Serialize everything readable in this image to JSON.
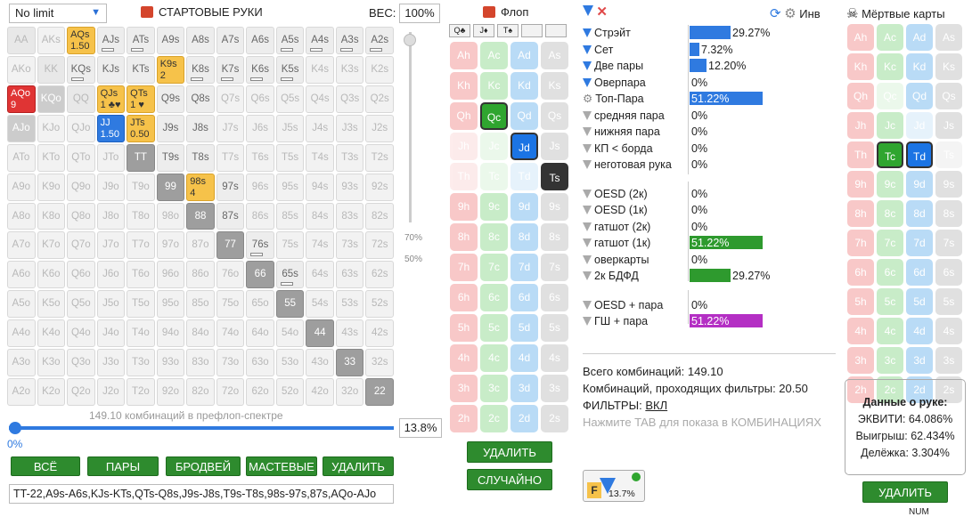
{
  "topbar": {
    "limit": "No limit",
    "title": "СТАРТОВЫЕ РУКИ",
    "weight_label": "ВЕС:",
    "weight_value": "100%"
  },
  "grid": [
    [
      {
        "t": "AA",
        "c": "pair"
      },
      {
        "t": "AKs"
      },
      {
        "t": "AQs",
        "c": "yel",
        "s": "1.50"
      },
      {
        "t": "AJs",
        "c": "dk",
        "bar": 1
      },
      {
        "t": "ATs",
        "c": "dk",
        "bar": 1
      },
      {
        "t": "A9s",
        "c": "dk"
      },
      {
        "t": "A8s",
        "c": "dk"
      },
      {
        "t": "A7s",
        "c": "dk"
      },
      {
        "t": "A6s",
        "c": "dk"
      },
      {
        "t": "A5s",
        "c": "dk",
        "bar": 1
      },
      {
        "t": "A4s",
        "c": "dk",
        "bar": 1
      },
      {
        "t": "A3s",
        "c": "dk",
        "bar": 1
      },
      {
        "t": "A2s",
        "c": "dk",
        "bar": 1
      }
    ],
    [
      {
        "t": "AKo"
      },
      {
        "t": "KK",
        "c": "pair"
      },
      {
        "t": "KQs",
        "c": "dk",
        "bar": 1
      },
      {
        "t": "KJs",
        "c": "dk"
      },
      {
        "t": "KTs",
        "c": "dk"
      },
      {
        "t": "K9s",
        "c": "yel",
        "s": "2"
      },
      {
        "t": "K8s",
        "c": "dk",
        "bar": 1
      },
      {
        "t": "K7s",
        "c": "dk",
        "bar": 1
      },
      {
        "t": "K6s",
        "c": "dk",
        "bar": 1
      },
      {
        "t": "K5s",
        "c": "dk",
        "bar": 1
      },
      {
        "t": "K4s"
      },
      {
        "t": "K3s"
      },
      {
        "t": "K2s"
      }
    ],
    [
      {
        "t": "AQo",
        "c": "red",
        "s": "9"
      },
      {
        "t": "KQo",
        "c": "mixed"
      },
      {
        "t": "QQ",
        "c": "pair"
      },
      {
        "t": "QJs",
        "c": "yel",
        "s": "1 ♣♥"
      },
      {
        "t": "QTs",
        "c": "yel",
        "s": "1 ♥"
      },
      {
        "t": "Q9s",
        "c": "dk"
      },
      {
        "t": "Q8s",
        "c": "dk"
      },
      {
        "t": "Q7s"
      },
      {
        "t": "Q6s"
      },
      {
        "t": "Q5s"
      },
      {
        "t": "Q4s"
      },
      {
        "t": "Q3s"
      },
      {
        "t": "Q2s"
      }
    ],
    [
      {
        "t": "AJo",
        "c": "mixed"
      },
      {
        "t": "KJo"
      },
      {
        "t": "QJo"
      },
      {
        "t": "JJ",
        "c": "blue",
        "s": "1.50"
      },
      {
        "t": "JTs",
        "c": "yel",
        "s": "0.50"
      },
      {
        "t": "J9s",
        "c": "dk"
      },
      {
        "t": "J8s",
        "c": "dk"
      },
      {
        "t": "J7s"
      },
      {
        "t": "J6s"
      },
      {
        "t": "J5s"
      },
      {
        "t": "J4s"
      },
      {
        "t": "J3s"
      },
      {
        "t": "J2s"
      }
    ],
    [
      {
        "t": "ATo"
      },
      {
        "t": "KTo"
      },
      {
        "t": "QTo"
      },
      {
        "t": "JTo"
      },
      {
        "t": "TT",
        "c": "gray"
      },
      {
        "t": "T9s",
        "c": "dk"
      },
      {
        "t": "T8s",
        "c": "dk"
      },
      {
        "t": "T7s"
      },
      {
        "t": "T6s"
      },
      {
        "t": "T5s"
      },
      {
        "t": "T4s"
      },
      {
        "t": "T3s"
      },
      {
        "t": "T2s"
      }
    ],
    [
      {
        "t": "A9o"
      },
      {
        "t": "K9o"
      },
      {
        "t": "Q9o"
      },
      {
        "t": "J9o"
      },
      {
        "t": "T9o"
      },
      {
        "t": "99",
        "c": "gray"
      },
      {
        "t": "98s",
        "c": "yel",
        "s": "4"
      },
      {
        "t": "97s",
        "c": "dk"
      },
      {
        "t": "96s"
      },
      {
        "t": "95s"
      },
      {
        "t": "94s"
      },
      {
        "t": "93s"
      },
      {
        "t": "92s"
      }
    ],
    [
      {
        "t": "A8o"
      },
      {
        "t": "K8o"
      },
      {
        "t": "Q8o"
      },
      {
        "t": "J8o"
      },
      {
        "t": "T8o"
      },
      {
        "t": "98o"
      },
      {
        "t": "88",
        "c": "gray"
      },
      {
        "t": "87s",
        "c": "dk"
      },
      {
        "t": "86s"
      },
      {
        "t": "85s"
      },
      {
        "t": "84s"
      },
      {
        "t": "83s"
      },
      {
        "t": "82s"
      }
    ],
    [
      {
        "t": "A7o"
      },
      {
        "t": "K7o"
      },
      {
        "t": "Q7o"
      },
      {
        "t": "J7o"
      },
      {
        "t": "T7o"
      },
      {
        "t": "97o"
      },
      {
        "t": "87o"
      },
      {
        "t": "77",
        "c": "gray"
      },
      {
        "t": "76s",
        "c": "dk",
        "bar": 1
      },
      {
        "t": "75s"
      },
      {
        "t": "74s"
      },
      {
        "t": "73s"
      },
      {
        "t": "72s"
      }
    ],
    [
      {
        "t": "A6o"
      },
      {
        "t": "K6o"
      },
      {
        "t": "Q6o"
      },
      {
        "t": "J6o"
      },
      {
        "t": "T6o"
      },
      {
        "t": "96o"
      },
      {
        "t": "86o"
      },
      {
        "t": "76o"
      },
      {
        "t": "66",
        "c": "gray"
      },
      {
        "t": "65s",
        "c": "dk",
        "bar": 1
      },
      {
        "t": "64s"
      },
      {
        "t": "63s"
      },
      {
        "t": "62s"
      }
    ],
    [
      {
        "t": "A5o"
      },
      {
        "t": "K5o"
      },
      {
        "t": "Q5o"
      },
      {
        "t": "J5o"
      },
      {
        "t": "T5o"
      },
      {
        "t": "95o"
      },
      {
        "t": "85o"
      },
      {
        "t": "75o"
      },
      {
        "t": "65o"
      },
      {
        "t": "55",
        "c": "gray"
      },
      {
        "t": "54s"
      },
      {
        "t": "53s"
      },
      {
        "t": "52s"
      }
    ],
    [
      {
        "t": "A4o"
      },
      {
        "t": "K4o"
      },
      {
        "t": "Q4o"
      },
      {
        "t": "J4o"
      },
      {
        "t": "T4o"
      },
      {
        "t": "94o"
      },
      {
        "t": "84o"
      },
      {
        "t": "74o"
      },
      {
        "t": "64o"
      },
      {
        "t": "54o"
      },
      {
        "t": "44",
        "c": "gray"
      },
      {
        "t": "43s"
      },
      {
        "t": "42s"
      }
    ],
    [
      {
        "t": "A3o"
      },
      {
        "t": "K3o"
      },
      {
        "t": "Q3o"
      },
      {
        "t": "J3o"
      },
      {
        "t": "T3o"
      },
      {
        "t": "93o"
      },
      {
        "t": "83o"
      },
      {
        "t": "73o"
      },
      {
        "t": "63o"
      },
      {
        "t": "53o"
      },
      {
        "t": "43o"
      },
      {
        "t": "33",
        "c": "gray"
      },
      {
        "t": "32s"
      }
    ],
    [
      {
        "t": "A2o"
      },
      {
        "t": "K2o"
      },
      {
        "t": "Q2o"
      },
      {
        "t": "J2o"
      },
      {
        "t": "T2o"
      },
      {
        "t": "92o"
      },
      {
        "t": "82o"
      },
      {
        "t": "72o"
      },
      {
        "t": "62o"
      },
      {
        "t": "52o"
      },
      {
        "t": "42o"
      },
      {
        "t": "32o"
      },
      {
        "t": "22",
        "c": "gray"
      }
    ]
  ],
  "slider": {
    "pct_a": "70%",
    "pct_b": "50%",
    "combos_label": "149.10 комбинаций в префлоп-спектре",
    "zero": "0%",
    "percent": "13.8%"
  },
  "buttons": {
    "all": "ВСЁ",
    "pairs": "ПАРЫ",
    "broadway": "БРОДВЕЙ",
    "suited": "МАСТЕВЫЕ",
    "delete": "УДАЛИТЬ"
  },
  "range_text": "TT-22,A9s-A6s,KJs-KTs,QTs-Q8s,J9s-J8s,T9s-T8s,98s-97s,87s,AQo-AJo",
  "flop": {
    "title": "Флоп",
    "slots": [
      "Q♣",
      "J♦",
      "T♠",
      "",
      ""
    ],
    "delete": "УДАЛИТЬ",
    "random": "СЛУЧАЙНО"
  },
  "ranks": [
    "A",
    "K",
    "Q",
    "J",
    "T",
    "9",
    "8",
    "7",
    "6",
    "5",
    "4",
    "3",
    "2"
  ],
  "filters": [
    {
      "label": "Стрэйт",
      "value": "29.27%",
      "pct": 29.27,
      "color": "#2f7ae0",
      "icon": "blue"
    },
    {
      "label": "Сет",
      "value": "7.32%",
      "pct": 7.32,
      "color": "#2f7ae0",
      "icon": "blue"
    },
    {
      "label": "Две пары",
      "value": "12.20%",
      "pct": 12.2,
      "color": "#2f7ae0",
      "icon": "blue"
    },
    {
      "label": "Оверпара",
      "value": "0%",
      "pct": 0,
      "color": "#2f7ae0",
      "icon": "blue"
    },
    {
      "label": "Топ-Пара",
      "value": "51.22%",
      "pct": 51.22,
      "color": "#2f7ae0",
      "icon": "gear",
      "inside": true
    },
    {
      "label": "средняя пара",
      "value": "0%",
      "pct": 0,
      "color": "#2f7ae0",
      "icon": "gray"
    },
    {
      "label": "нижняя пара",
      "value": "0%",
      "pct": 0,
      "color": "#2f7ae0",
      "icon": "gray"
    },
    {
      "label": "КП < борда",
      "value": "0%",
      "pct": 0,
      "color": "#2f7ae0",
      "icon": "gray"
    },
    {
      "label": "неготовая рука",
      "value": "0%",
      "pct": 0,
      "color": "#2f7ae0",
      "icon": "gray"
    },
    {
      "gap": true
    },
    {
      "label": "OESD (2к)",
      "value": "0%",
      "pct": 0,
      "color": "#2e9a2e",
      "icon": "gray"
    },
    {
      "label": "OESD (1к)",
      "value": "0%",
      "pct": 0,
      "color": "#2e9a2e",
      "icon": "gray"
    },
    {
      "label": "гатшот (2к)",
      "value": "0%",
      "pct": 0,
      "color": "#2e9a2e",
      "icon": "gray"
    },
    {
      "label": "гатшот (1к)",
      "value": "51.22%",
      "pct": 51.22,
      "color": "#2e9a2e",
      "icon": "gray",
      "inside": true
    },
    {
      "label": "оверкарты",
      "value": "0%",
      "pct": 0,
      "color": "#2e9a2e",
      "icon": "gray"
    },
    {
      "label": "2к БДФД",
      "value": "29.27%",
      "pct": 29.27,
      "color": "#2e9a2e",
      "icon": "gray"
    },
    {
      "gap": true
    },
    {
      "label": "OESD + пара",
      "value": "0%",
      "pct": 0,
      "color": "#b42fc4",
      "icon": "gray"
    },
    {
      "label": "ГШ + пара",
      "value": "51.22%",
      "pct": 51.22,
      "color": "#b42fc4",
      "icon": "gray",
      "inside": true
    }
  ],
  "totals": {
    "all": "Всего комбинаций: 149.10",
    "pass": "Комбинаций, проходящих фильтры: 20.50",
    "filters_label": "ФИЛЬТРЫ:",
    "filters_state": "ВКЛ",
    "hint": "Нажмите TAB для показа в КОМБИНАЦИЯХ"
  },
  "fbutton": {
    "pct": "13.7%",
    "letter": "F"
  },
  "right": {
    "inv": "Инв",
    "dead": "Мёртвые карты",
    "info_title": "Данные о руке:",
    "equity": "ЭКВИТИ: 64.086%",
    "win": "Выигрыш: 62.434%",
    "tie": "Делёжка: 3.304%",
    "delete": "УДАЛИТЬ"
  },
  "status": "NUM"
}
